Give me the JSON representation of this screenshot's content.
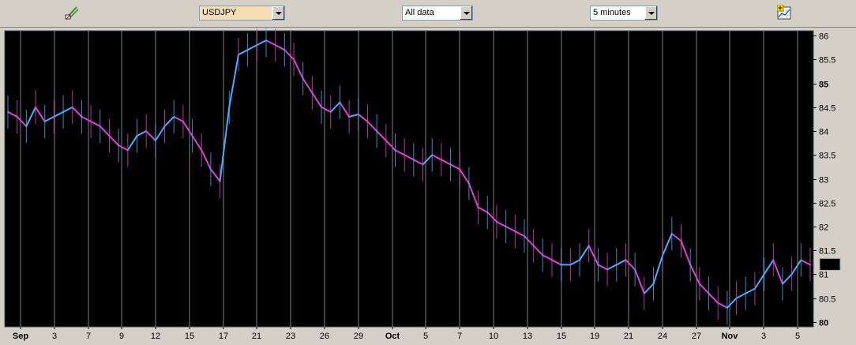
{
  "toolbar": {
    "symbol_value": "USDJPY",
    "range_value": "All data",
    "interval_value": "5 minutes",
    "symbol_bg": "#f5deb3"
  },
  "chart_data": {
    "type": "line",
    "colors": {
      "up": "#40b0ff",
      "down": "#e040d8",
      "background": "#000000",
      "grid": "#808080"
    },
    "ylim": [
      79.9,
      86.1
    ],
    "yticks": [
      {
        "label": "86",
        "value": 86,
        "bold": false
      },
      {
        "label": "85.5",
        "value": 85.5,
        "bold": false
      },
      {
        "label": "85",
        "value": 85,
        "bold": true
      },
      {
        "label": "84.5",
        "value": 84.5,
        "bold": false
      },
      {
        "label": "84",
        "value": 84,
        "bold": false
      },
      {
        "label": "83.5",
        "value": 83.5,
        "bold": false
      },
      {
        "label": "83",
        "value": 83,
        "bold": false
      },
      {
        "label": "82.5",
        "value": 82.5,
        "bold": false
      },
      {
        "label": "82",
        "value": 82,
        "bold": false
      },
      {
        "label": "81.5",
        "value": 81.5,
        "bold": false
      },
      {
        "label": "81",
        "value": 81,
        "bold": false
      },
      {
        "label": "80.5",
        "value": 80.5,
        "bold": false
      },
      {
        "label": "80",
        "value": 80,
        "bold": true
      }
    ],
    "last_price": "81.2",
    "last_value": 81.2,
    "xticks": [
      {
        "label": "Sep",
        "index": 0,
        "bold": true
      },
      {
        "label": "3",
        "index": 2,
        "bold": false
      },
      {
        "label": "7",
        "index": 3,
        "bold": false
      },
      {
        "label": "9",
        "index": 5,
        "bold": false
      },
      {
        "label": "12",
        "index": 7,
        "bold": false
      },
      {
        "label": "15",
        "index": 10,
        "bold": false
      },
      {
        "label": "17",
        "index": 12,
        "bold": false
      },
      {
        "label": "21",
        "index": 14,
        "bold": false
      },
      {
        "label": "23",
        "index": 16,
        "bold": false
      },
      {
        "label": "26",
        "index": 18,
        "bold": false
      },
      {
        "label": "29",
        "index": 20,
        "bold": false
      },
      {
        "label": "Oct",
        "index": 22,
        "bold": true
      },
      {
        "label": "5",
        "index": 24,
        "bold": false
      },
      {
        "label": "7",
        "index": 26,
        "bold": false
      },
      {
        "label": "10",
        "index": 28,
        "bold": false
      },
      {
        "label": "13",
        "index": 30,
        "bold": false
      },
      {
        "label": "15",
        "index": 32,
        "bold": false
      },
      {
        "label": "19",
        "index": 34,
        "bold": false
      },
      {
        "label": "21",
        "index": 36,
        "bold": false
      },
      {
        "label": "24",
        "index": 38,
        "bold": false
      },
      {
        "label": "27",
        "index": 40,
        "bold": false
      },
      {
        "label": "Nov",
        "index": 43,
        "bold": true
      },
      {
        "label": "3",
        "index": 45,
        "bold": false
      },
      {
        "label": "5",
        "index": 47,
        "bold": false
      }
    ],
    "series": [
      {
        "values": [
          84.4,
          84.3,
          84.1,
          84.5,
          84.2,
          84.3,
          84.4,
          84.5,
          84.3,
          84.2,
          84.1,
          83.9,
          83.7,
          83.6,
          83.9,
          84.0,
          83.8,
          84.1,
          84.3,
          84.2,
          83.9,
          83.6,
          83.2,
          82.95,
          84.5,
          85.6,
          85.7,
          85.8,
          85.9,
          85.8,
          85.7,
          85.5,
          85.1,
          84.8,
          84.5,
          84.4,
          84.6,
          84.3,
          84.35,
          84.2,
          84.0,
          83.8,
          83.6,
          83.5,
          83.4,
          83.3,
          83.5,
          83.4,
          83.3,
          83.2,
          82.9,
          82.4,
          82.3,
          82.1,
          82.0,
          81.9,
          81.8,
          81.6,
          81.4,
          81.3,
          81.2,
          81.2,
          81.3,
          81.6,
          81.2,
          81.1,
          81.2,
          81.3,
          81.1,
          80.6,
          80.8,
          81.4,
          81.85,
          81.7,
          81.2,
          80.8,
          80.6,
          80.4,
          80.3,
          80.5,
          80.6,
          80.7,
          81.0,
          81.3,
          80.8,
          81.0,
          81.3,
          81.2
        ]
      }
    ]
  }
}
